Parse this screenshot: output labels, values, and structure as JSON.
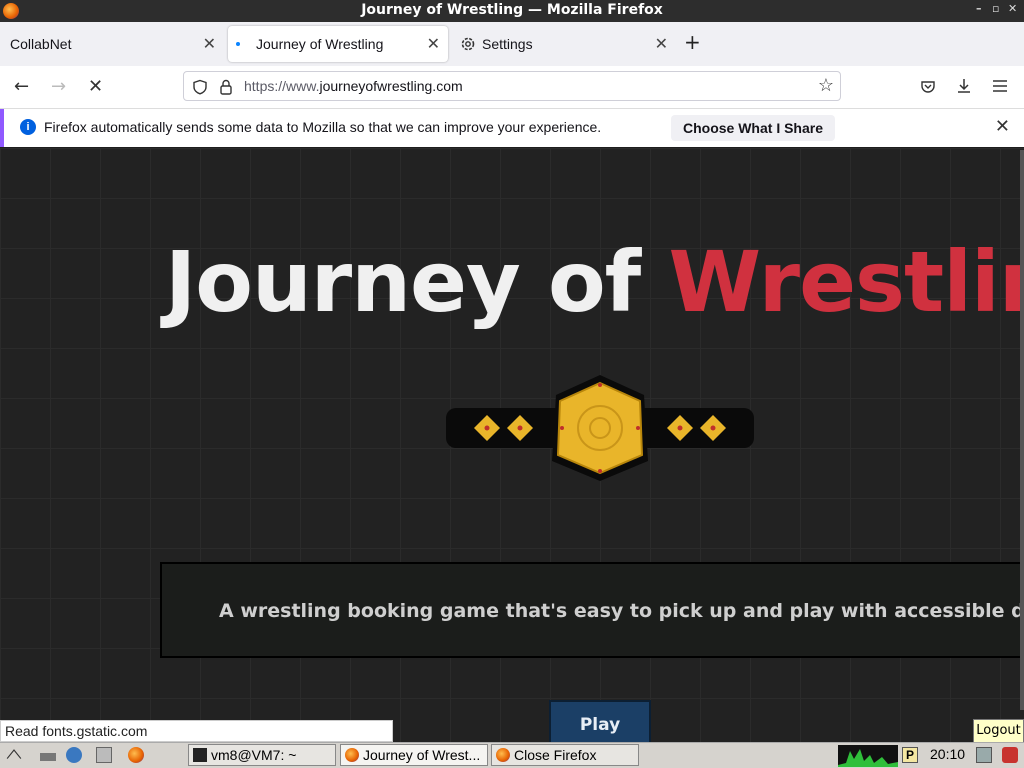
{
  "window": {
    "title": "Journey of Wrestling — Mozilla Firefox"
  },
  "tabs": [
    {
      "label": "CollabNet"
    },
    {
      "label": "Journey of Wrestling"
    },
    {
      "label": "Settings"
    }
  ],
  "url": {
    "prefix": "https://www.",
    "domain": "journeyofwrestling.com"
  },
  "notification": {
    "message": "Firefox automatically sends some data to Mozilla so that we can improve your experience.",
    "button": "Choose What I Share"
  },
  "page": {
    "title_part1": "Journey of",
    "title_part2": "Wrestling",
    "tagline": "A wrestling booking game that's easy to pick up and play with accessible depth.",
    "play": "Play"
  },
  "status_text": "Read fonts.gstatic.com",
  "tooltip": "Logout",
  "taskbar": {
    "items": [
      {
        "label": "vm8@VM7: ~"
      },
      {
        "label": "Journey of Wrest..."
      },
      {
        "label": "Close Firefox"
      }
    ],
    "clock": "20:10"
  },
  "colors": {
    "accent_red": "#d0313f",
    "play_bg": "#1b3f66",
    "page_bg": "#222222"
  }
}
